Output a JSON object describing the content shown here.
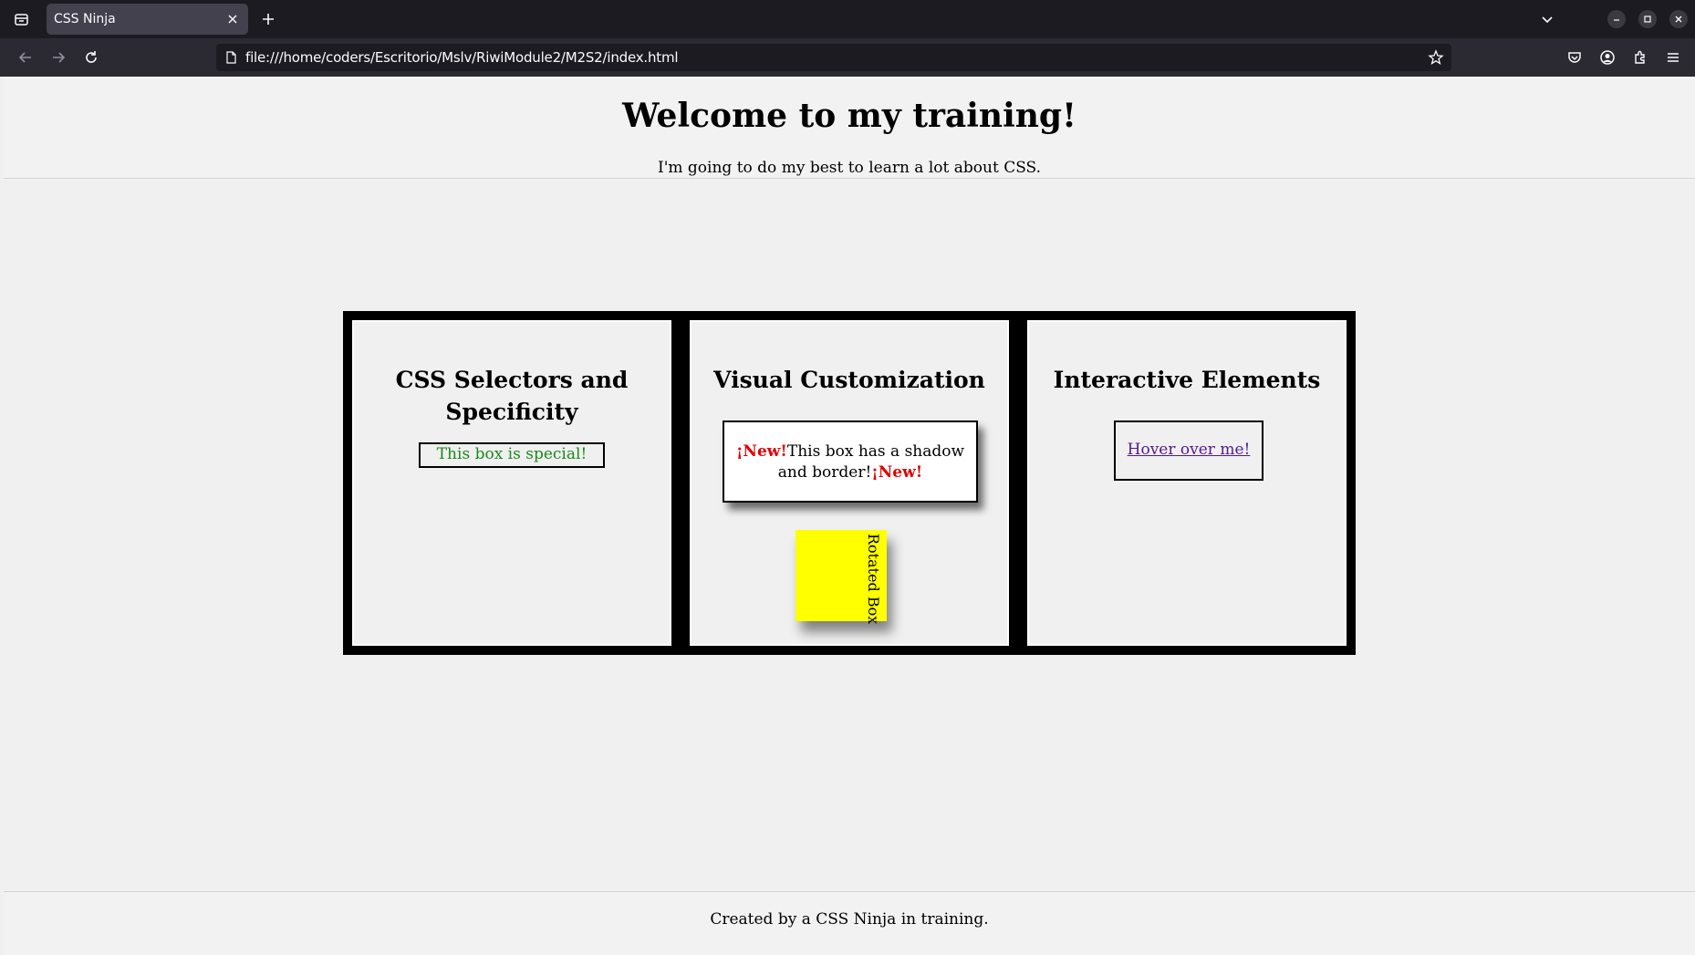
{
  "browser": {
    "tab_title": "CSS Ninja",
    "url": "file:///home/coders/Escritorio/Mslv/RiwiModule2/M2S2/index.html"
  },
  "header": {
    "title": "Welcome to my training!",
    "tagline": "I'm going to do my best to learn a lot about CSS."
  },
  "cards": [
    {
      "title": "CSS Selectors and Specificity",
      "special_box": "This box is special!"
    },
    {
      "title": "Visual Customization",
      "new_tag": "¡New!",
      "shadow_box_text": "This box has a shadow and border!",
      "rotated_box": "Rotated Box"
    },
    {
      "title": "Interactive Elements",
      "hover_link": "Hover over me!"
    }
  ],
  "footer": {
    "text": "Created by a CSS Ninja in training."
  },
  "colors": {
    "special_text": "#1a8a1a",
    "new_tag": "#e00000",
    "rotated_box": "#ffff00",
    "link": "#551a8b"
  }
}
